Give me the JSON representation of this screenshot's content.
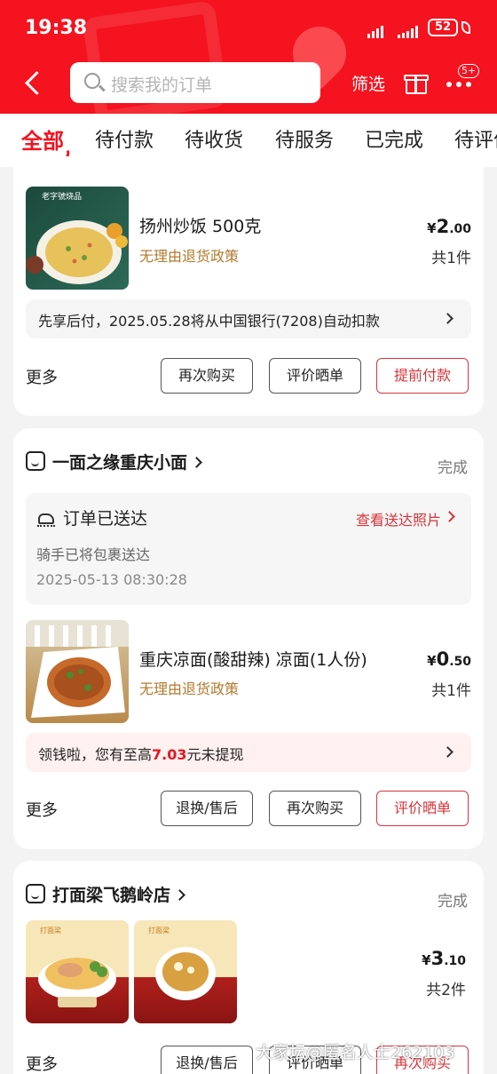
{
  "status_bar": {
    "time": "19:38",
    "battery": "52"
  },
  "header": {
    "search_placeholder": "搜索我的订单",
    "filter_label": "筛选",
    "more_badge": "5+",
    "icons": [
      "back-icon",
      "search-icon",
      "gift-icon",
      "more-icon"
    ]
  },
  "tabs": [
    "全部",
    "待付款",
    "待收货",
    "待服务",
    "已完成",
    "待评价"
  ],
  "orders": [
    {
      "product_name": "扬州炒饭 500克",
      "image_caption": "老字號烧品",
      "policy": "无理由退货政策",
      "price": {
        "currency": "¥",
        "int": "2",
        "dec": ".00"
      },
      "qty": "共1件",
      "info_bar": "先享后付，2025.05.28将从中国银行(7208)自动扣款",
      "more": "更多",
      "buttons": [
        "再次购买",
        "评价晒单",
        "提前付款"
      ]
    },
    {
      "shop": "一面之缘重庆小面",
      "status": "完成",
      "delivery": {
        "title": "订单已送达",
        "photo_link": "查看送达照片",
        "sub": "骑手已将包裹送达",
        "time": "2025-05-13 08:30:28"
      },
      "product_name": "重庆凉面(酸甜辣) 凉面(1人份)",
      "policy": "无理由退货政策",
      "price": {
        "currency": "¥",
        "int": "0",
        "dec": ".50"
      },
      "qty": "共1件",
      "info_bar": {
        "pre": "领钱啦，您有至高",
        "amount": "7.03",
        "post": "元未提现"
      },
      "more": "更多",
      "buttons": [
        "退换/售后",
        "再次购买",
        "评价晒单"
      ]
    },
    {
      "shop": "打面梁飞鹅岭店",
      "status": "完成",
      "image_captions": [
        "打面梁",
        "打面梁"
      ],
      "price": {
        "currency": "¥",
        "int": "3",
        "dec": ".10"
      },
      "qty": "共2件",
      "more": "更多",
      "buttons": [
        "退换/售后",
        "评价晒单",
        "再次购买"
      ]
    }
  ],
  "watermark": "大家坛@匿名人士262103"
}
